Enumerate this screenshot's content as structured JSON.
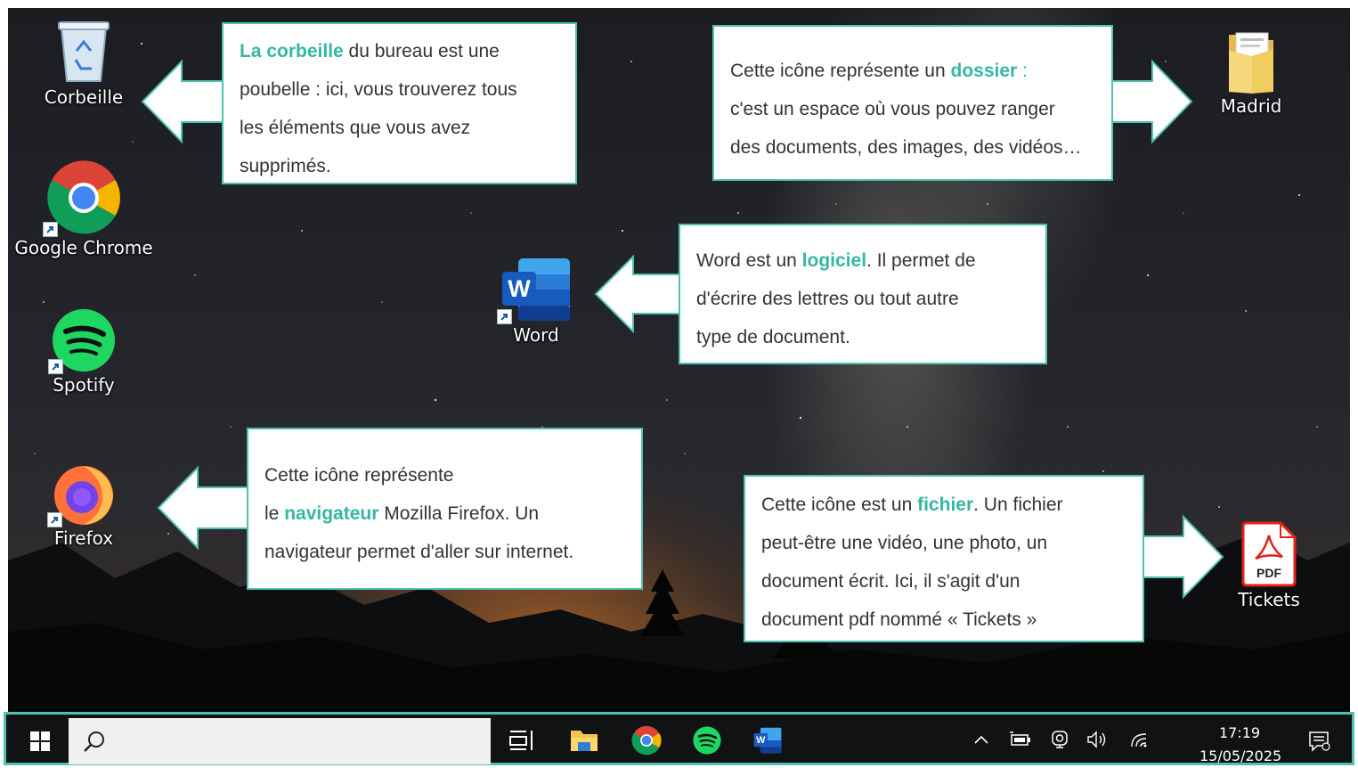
{
  "desktop_icons": {
    "recycle_bin": "Corbeille",
    "chrome": "Google Chrome",
    "spotify": "Spotify",
    "firefox": "Firefox",
    "word": "Word",
    "folder": "Madrid",
    "pdf": "Tickets",
    "pdf_badge": "PDF",
    "word_letter": "W"
  },
  "callouts": {
    "corbeille": {
      "highlight": "La corbeille",
      "l1_rest": " du bureau est une",
      "l2": "poubelle : ici, vous trouverez tous",
      "l3": "les éléments que vous avez",
      "l4": "supprimés."
    },
    "dossier": {
      "l1_pre": "Cette icône représente un ",
      "highlight": "dossier",
      "l1_post": " :",
      "l2": "c'est un espace où vous pouvez ranger",
      "l3": "des documents, des images, des vidéos…"
    },
    "logiciel": {
      "l1_pre": "Word est un ",
      "highlight": "logiciel",
      "l1_post": ". Il permet de",
      "l2": "d'écrire des lettres ou tout autre",
      "l3": "type de document."
    },
    "navigateur": {
      "l1": "Cette icône représente",
      "l2_pre": "le ",
      "highlight": "navigateur",
      "l2_post": " Mozilla Firefox. Un",
      "l3": "navigateur permet d'aller sur internet."
    },
    "fichier": {
      "l1_pre": "Cette icône est un ",
      "highlight": "fichier",
      "l1_post": ". Un fichier",
      "l2": "peut-être une vidéo, une photo, un",
      "l3": "document écrit. Ici, il s'agit d'un",
      "l4": "document pdf nommé « Tickets »"
    }
  },
  "taskbar": {
    "search_value": "",
    "time": "17:19",
    "date": "15/05/2025",
    "word_letter": "W"
  },
  "colors": {
    "accent": "#4fc1b0",
    "highlight_text": "#34b7a3"
  }
}
